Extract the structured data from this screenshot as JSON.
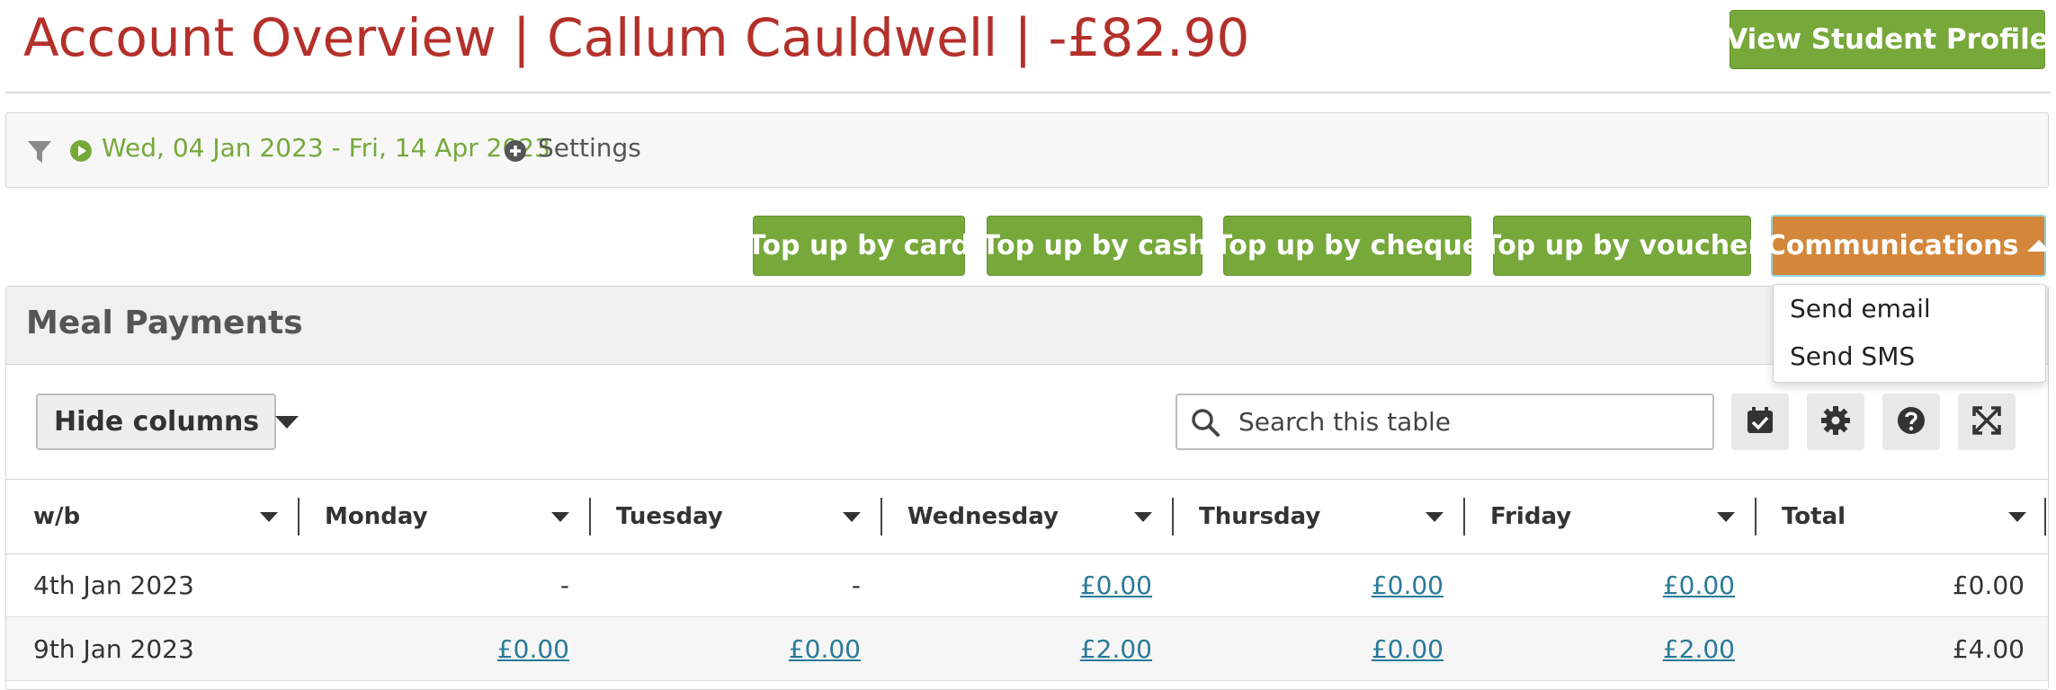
{
  "header": {
    "title": "Account Overview | Callum Cauldwell | -£82.90",
    "profile_button": "View Student Profile"
  },
  "filter_bar": {
    "filter_icon": "filter-icon",
    "play_icon": "play-circle-icon",
    "date_range": "Wed, 04 Jan 2023 - Fri, 14 Apr 2023",
    "settings_icon": "plus-circle-icon",
    "settings_label": "Settings"
  },
  "actions": {
    "top_up_card": "Top up by card",
    "top_up_cash": "Top up by cash",
    "top_up_cheque": "Top up by cheque",
    "top_up_voucher": "Top up by voucher",
    "communications": "Communications"
  },
  "communications_menu": {
    "items": [
      "Send email",
      "Send SMS"
    ]
  },
  "panel": {
    "title": "Meal Payments",
    "hide_columns": "Hide columns",
    "search_placeholder": "Search this table",
    "tools": [
      "calendar-check-icon",
      "gear-icon",
      "help-icon",
      "expand-icon"
    ]
  },
  "table": {
    "columns": [
      "w/b",
      "Monday",
      "Tuesday",
      "Wednesday",
      "Thursday",
      "Friday",
      "Total"
    ],
    "rows": [
      {
        "wb": "4th Jan 2023",
        "mon": "-",
        "tue": "-",
        "wed": "£0.00",
        "thu": "£0.00",
        "fri": "£0.00",
        "total": "£0.00"
      },
      {
        "wb": "9th Jan 2023",
        "mon": "£0.00",
        "tue": "£0.00",
        "wed": "£2.00",
        "thu": "£0.00",
        "fri": "£2.00",
        "total": "£4.00"
      }
    ]
  },
  "colors": {
    "title_red": "#b4302b",
    "action_green": "#76a83a",
    "communications_orange": "#d4873a",
    "link_blue": "#2a7a9a"
  }
}
